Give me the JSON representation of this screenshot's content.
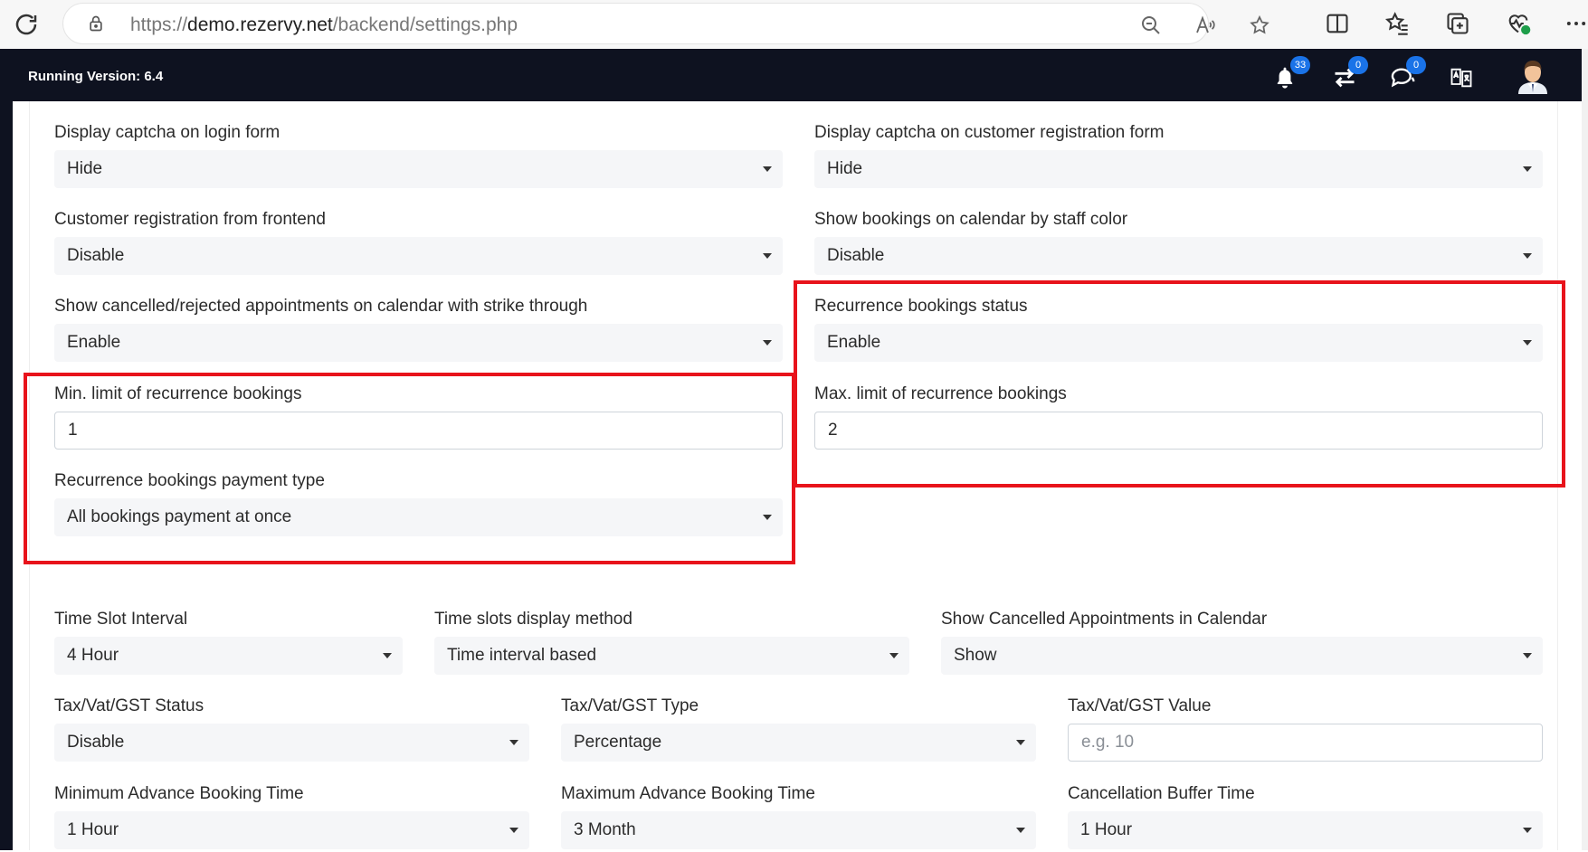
{
  "browser": {
    "url_prefix": "https://",
    "url_host": "demo.rezervy.net",
    "url_path": "/backend/settings.php"
  },
  "header": {
    "version_label": "Running Version: 6.4",
    "notifications_count": "33",
    "transfers_count": "0",
    "messages_count": "0"
  },
  "settings": {
    "captcha_login": {
      "label": "Display captcha on login form",
      "value": "Hide"
    },
    "captcha_registration": {
      "label": "Display captcha on customer registration form",
      "value": "Hide"
    },
    "customer_registration": {
      "label": "Customer registration from frontend",
      "value": "Disable"
    },
    "staff_color": {
      "label": "Show bookings on calendar by staff color",
      "value": "Disable"
    },
    "strike_through": {
      "label": "Show cancelled/rejected appointments on calendar with strike through",
      "value": "Enable"
    },
    "recurrence_status": {
      "label": "Recurrence bookings status",
      "value": "Enable"
    },
    "recurrence_min": {
      "label": "Min. limit of recurrence bookings",
      "value": "1"
    },
    "recurrence_max": {
      "label": "Max. limit of recurrence bookings",
      "value": "2"
    },
    "recurrence_payment": {
      "label": "Recurrence bookings payment type",
      "value": "All bookings payment at once"
    },
    "time_slot_interval": {
      "label": "Time Slot Interval",
      "value": "4 Hour"
    },
    "time_slot_display": {
      "label": "Time slots display method",
      "value": "Time interval based"
    },
    "show_cancelled": {
      "label": "Show Cancelled Appointments in Calendar",
      "value": "Show"
    },
    "tax_status": {
      "label": "Tax/Vat/GST Status",
      "value": "Disable"
    },
    "tax_type": {
      "label": "Tax/Vat/GST Type",
      "value": "Percentage"
    },
    "tax_value": {
      "label": "Tax/Vat/GST Value",
      "value": "",
      "placeholder": "e.g. 10"
    },
    "min_advance": {
      "label": "Minimum Advance Booking Time",
      "value": "1 Hour"
    },
    "max_advance": {
      "label": "Maximum Advance Booking Time",
      "value": "3 Month"
    },
    "cancellation_buffer": {
      "label": "Cancellation Buffer Time",
      "value": "1 Hour"
    }
  },
  "colors": {
    "header_bg": "#0e1220",
    "highlight": "#e8131b",
    "badge": "#1a73e8"
  }
}
